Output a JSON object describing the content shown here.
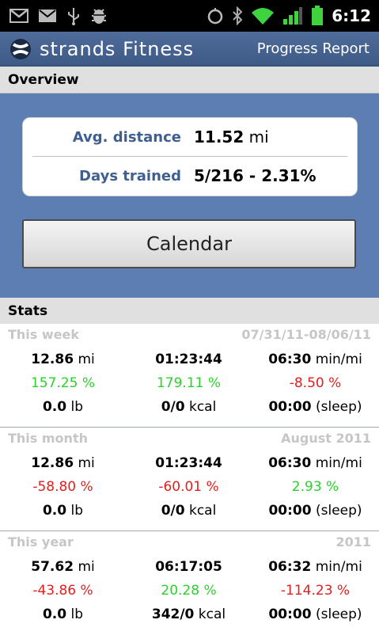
{
  "status_bar": {
    "time": "6:12"
  },
  "app": {
    "logo_text": "strands Fitness",
    "title": "Progress Report"
  },
  "overview": {
    "header": "Overview",
    "avg_distance_label": "Avg. distance",
    "avg_distance_value": "11.52",
    "avg_distance_unit": "mi",
    "days_trained_label": "Days trained",
    "days_trained_value": "5/216 - 2.31%",
    "calendar_button": "Calendar"
  },
  "stats": {
    "header": "Stats",
    "blocks": [
      {
        "title": "This week",
        "range": "07/31/11-08/06/11",
        "distance": "12.86",
        "distance_unit": "mi",
        "time": "01:23:44",
        "pace": "06:30",
        "pace_unit": "min/mi",
        "distance_change": "157.25 %",
        "time_change": "179.11 %",
        "pace_change": "-8.50 %",
        "weight": "0.0",
        "weight_unit": "lb",
        "kcal": "0/0",
        "kcal_unit": "kcal",
        "sleep": "00:00",
        "sleep_unit": "(sleep)"
      },
      {
        "title": "This month",
        "range": "August 2011",
        "distance": "12.86",
        "distance_unit": "mi",
        "time": "01:23:44",
        "pace": "06:30",
        "pace_unit": "min/mi",
        "distance_change": "-58.80 %",
        "time_change": "-60.01 %",
        "pace_change": "2.93 %",
        "weight": "0.0",
        "weight_unit": "lb",
        "kcal": "0/0",
        "kcal_unit": "kcal",
        "sleep": "00:00",
        "sleep_unit": "(sleep)"
      },
      {
        "title": "This year",
        "range": "2011",
        "distance": "57.62",
        "distance_unit": "mi",
        "time": "06:17:05",
        "pace": "06:32",
        "pace_unit": "min/mi",
        "distance_change": "-43.86 %",
        "time_change": "20.28 %",
        "pace_change": "-114.23 %",
        "weight": "0.0",
        "weight_unit": "lb",
        "kcal": "342/0",
        "kcal_unit": "kcal",
        "sleep": "00:00",
        "sleep_unit": "(sleep)"
      }
    ]
  },
  "colors": {
    "positive": "#2bd12b",
    "negative": "#e02020",
    "accent": "#5c7eb2",
    "label": "#3f5f91"
  },
  "icons": [
    "gmail-icon",
    "email-icon",
    "usb-icon",
    "android-debug-icon",
    "alarm-icon",
    "bluetooth-icon",
    "wifi-icon",
    "signal-icon",
    "battery-icon",
    "strands-logo-icon"
  ]
}
